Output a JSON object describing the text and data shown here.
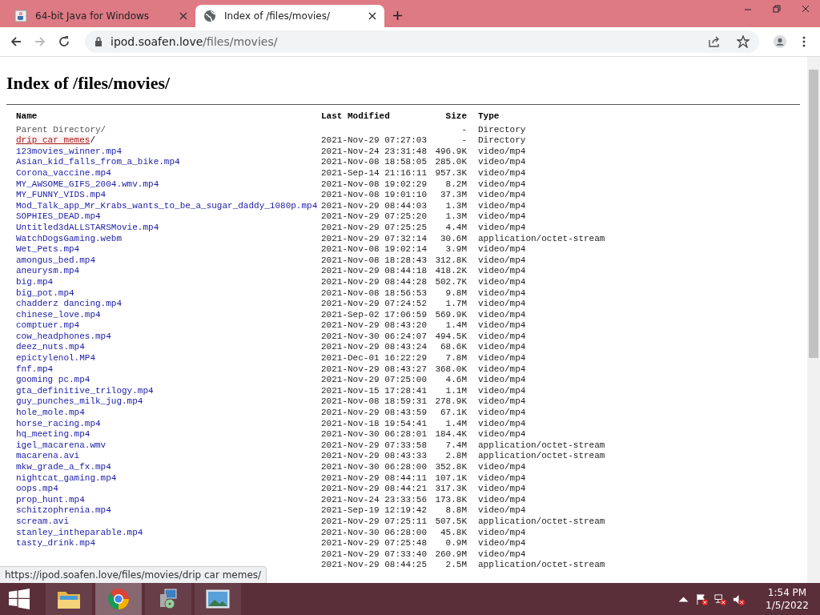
{
  "tabs": [
    {
      "title": "64-bit Java for Windows",
      "selected": false
    },
    {
      "title": "Index of /files/movies/",
      "selected": true
    }
  ],
  "address": {
    "host": "ipod.soafen.love",
    "path": "/files/movies/"
  },
  "heading": "Index of /files/movies/",
  "table": {
    "columns": [
      "Name",
      "Last Modified",
      "Size",
      "Type"
    ],
    "rows": [
      {
        "kind": "parent",
        "name": "Parent Directory/",
        "size": "-",
        "type": "Directory"
      },
      {
        "kind": "dir",
        "name": "drip car memes",
        "suffix": "/",
        "modified": "2021-Nov-29 07:27:03",
        "size": "-",
        "type": "Directory",
        "hovered": true
      },
      {
        "kind": "file",
        "name": "123movies_winner.mp4",
        "modified": "2021-Nov-24 23:31:48",
        "size": "496.9K",
        "type": "video/mp4",
        "hovered": false
      },
      {
        "kind": "file",
        "name": "Asian_kid_falls_from_a_bike.mp4",
        "modified": "2021-Nov-08 18:58:05",
        "size": "285.0K",
        "type": "video/mp4",
        "hovered": false
      },
      {
        "kind": "file",
        "name": "Corona_vaccine.mp4",
        "modified": "2021-Sep-14 21:16:11",
        "size": "957.3K",
        "type": "video/mp4",
        "hovered": false
      },
      {
        "kind": "file",
        "name": "MY_AWSOME_GIFS_2004.wmv.mp4",
        "modified": "2021-Nov-08 19:02:29",
        "size": "8.2M",
        "type": "video/mp4",
        "hovered": false
      },
      {
        "kind": "file",
        "name": "MY_FUNNY_VIDS.mp4",
        "modified": "2021-Nov-08 19:01:10",
        "size": "37.3M",
        "type": "video/mp4",
        "hovered": false
      },
      {
        "kind": "file",
        "name": "Mod_Talk_app_Mr_Krabs_wants_to_be_a_sugar_daddy_1080p.mp4",
        "modified": "2021-Nov-29 08:44:03",
        "size": "1.3M",
        "type": "video/mp4",
        "hovered": false
      },
      {
        "kind": "file",
        "name": "SOPHIES_DEAD.mp4",
        "modified": "2021-Nov-29 07:25:20",
        "size": "1.3M",
        "type": "video/mp4",
        "hovered": false
      },
      {
        "kind": "file",
        "name": "Untitled3dALLSTARSMovie.mp4",
        "modified": "2021-Nov-29 07:25:25",
        "size": "4.4M",
        "type": "video/mp4",
        "hovered": false
      },
      {
        "kind": "file",
        "name": "WatchDogsGaming.webm",
        "modified": "2021-Nov-29 07:32:14",
        "size": "30.6M",
        "type": "application/octet-stream",
        "hovered": false
      },
      {
        "kind": "file",
        "name": "Wet_Pets.mp4",
        "modified": "2021-Nov-08 19:02:14",
        "size": "3.9M",
        "type": "video/mp4",
        "hovered": false
      },
      {
        "kind": "file",
        "name": "amongus_bed.mp4",
        "modified": "2021-Nov-08 18:28:43",
        "size": "312.8K",
        "type": "video/mp4",
        "hovered": false
      },
      {
        "kind": "file",
        "name": "aneurysm.mp4",
        "modified": "2021-Nov-29 08:44:18",
        "size": "418.2K",
        "type": "video/mp4",
        "hovered": false
      },
      {
        "kind": "file",
        "name": "big.mp4",
        "modified": "2021-Nov-29 08:44:28",
        "size": "502.7K",
        "type": "video/mp4",
        "hovered": false
      },
      {
        "kind": "file",
        "name": "big_pot.mp4",
        "modified": "2021-Nov-08 18:56:53",
        "size": "9.8M",
        "type": "video/mp4",
        "hovered": false
      },
      {
        "kind": "file",
        "name": "chadderz dancing.mp4",
        "modified": "2021-Nov-29 07:24:52",
        "size": "1.7M",
        "type": "video/mp4",
        "hovered": false
      },
      {
        "kind": "file",
        "name": "chinese_love.mp4",
        "modified": "2021-Sep-02 17:06:59",
        "size": "569.9K",
        "type": "video/mp4",
        "hovered": false
      },
      {
        "kind": "file",
        "name": "comptuer.mp4",
        "modified": "2021-Nov-29 08:43:20",
        "size": "1.4M",
        "type": "video/mp4",
        "hovered": false
      },
      {
        "kind": "file",
        "name": "cow_headphones.mp4",
        "modified": "2021-Nov-30 06:24:07",
        "size": "494.5K",
        "type": "video/mp4",
        "hovered": false
      },
      {
        "kind": "file",
        "name": "deez_nuts.mp4",
        "modified": "2021-Nov-29 08:43:24",
        "size": "68.6K",
        "type": "video/mp4",
        "hovered": false
      },
      {
        "kind": "file",
        "name": "epictylenol.MP4",
        "modified": "2021-Dec-01 16:22:29",
        "size": "7.8M",
        "type": "video/mp4",
        "hovered": false
      },
      {
        "kind": "file",
        "name": "fnf.mp4",
        "modified": "2021-Nov-29 08:43:27",
        "size": "368.0K",
        "type": "video/mp4",
        "hovered": false
      },
      {
        "kind": "file",
        "name": "gooming pc.mp4",
        "modified": "2021-Nov-29 07:25:00",
        "size": "4.6M",
        "type": "video/mp4",
        "hovered": false
      },
      {
        "kind": "file",
        "name": "gta_definitive_trilogy.mp4",
        "modified": "2021-Nov-15 17:28:41",
        "size": "1.1M",
        "type": "video/mp4",
        "hovered": false
      },
      {
        "kind": "file",
        "name": "guy_punches_milk_jug.mp4",
        "modified": "2021-Nov-08 18:59:31",
        "size": "278.9K",
        "type": "video/mp4",
        "hovered": false
      },
      {
        "kind": "file",
        "name": "hole_mole.mp4",
        "modified": "2021-Nov-29 08:43:59",
        "size": "67.1K",
        "type": "video/mp4",
        "hovered": false
      },
      {
        "kind": "file",
        "name": "horse_racing.mp4",
        "modified": "2021-Nov-18 19:54:41",
        "size": "1.4M",
        "type": "video/mp4",
        "hovered": false
      },
      {
        "kind": "file",
        "name": "hq_meeting.mp4",
        "modified": "2021-Nov-30 06:28:01",
        "size": "184.4K",
        "type": "video/mp4",
        "hovered": false
      },
      {
        "kind": "file",
        "name": "igel_macarena.wmv",
        "modified": "2021-Nov-29 07:33:58",
        "size": "7.4M",
        "type": "application/octet-stream",
        "hovered": false
      },
      {
        "kind": "file",
        "name": "macarena.avi",
        "modified": "2021-Nov-29 08:43:33",
        "size": "2.8M",
        "type": "application/octet-stream",
        "hovered": false
      },
      {
        "kind": "file",
        "name": "mkw_grade_a_fx.mp4",
        "modified": "2021-Nov-30 06:28:00",
        "size": "352.8K",
        "type": "video/mp4",
        "hovered": false
      },
      {
        "kind": "file",
        "name": "nightcat_gaming.mp4",
        "modified": "2021-Nov-29 08:44:11",
        "size": "107.1K",
        "type": "video/mp4",
        "hovered": false
      },
      {
        "kind": "file",
        "name": "oops.mp4",
        "modified": "2021-Nov-29 08:44:21",
        "size": "317.3K",
        "type": "video/mp4",
        "hovered": false
      },
      {
        "kind": "file",
        "name": "prop_hunt.mp4",
        "modified": "2021-Nov-24 23:33:56",
        "size": "173.8K",
        "type": "video/mp4",
        "hovered": false
      },
      {
        "kind": "file",
        "name": "schitzophrenia.mp4",
        "modified": "2021-Sep-19 12:19:42",
        "size": "8.8M",
        "type": "video/mp4",
        "hovered": false
      },
      {
        "kind": "file",
        "name": "scream.avi",
        "modified": "2021-Nov-29 07:25:11",
        "size": "507.5K",
        "type": "application/octet-stream",
        "hovered": false
      },
      {
        "kind": "file",
        "name": "stanley_intheparable.mp4",
        "modified": "2021-Nov-30 06:28:00",
        "size": "45.8K",
        "type": "video/mp4",
        "hovered": false
      },
      {
        "kind": "file",
        "name": "tasty_drink.mp4",
        "modified": "2021-Nov-29 07:25:48",
        "size": "0.9M",
        "type": "video/mp4",
        "hovered": false
      },
      {
        "kind": "file",
        "modified": "2021-Nov-29 07:33:40",
        "size": "260.9M",
        "type": "video/mp4"
      },
      {
        "kind": "file",
        "modified": "2021-Nov-29 08:44:25",
        "size": "2.5M",
        "type": "application/octet-stream"
      }
    ]
  },
  "status_url": "https://ipod.soafen.love/files/movies/drip car memes/",
  "taskbar": {
    "apps": [
      {
        "selected": false
      },
      {
        "selected": true
      },
      {
        "selected": false
      },
      {
        "selected": false
      }
    ],
    "time": "1:54 PM",
    "date": "1/5/2022"
  }
}
